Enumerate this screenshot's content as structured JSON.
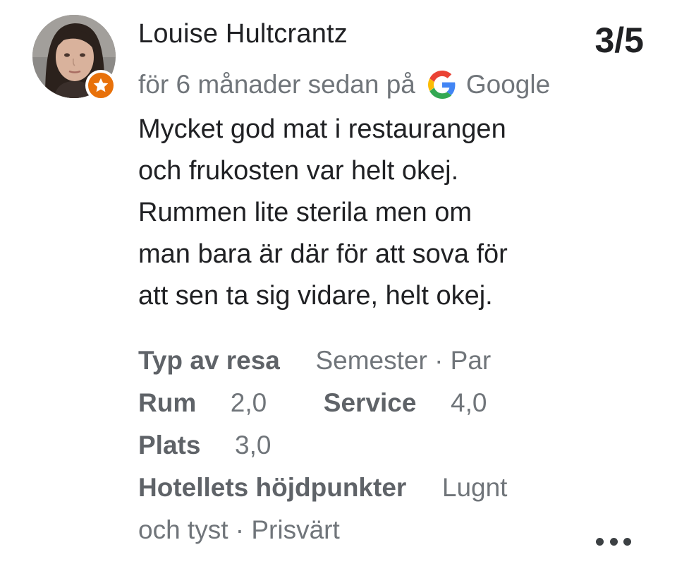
{
  "review": {
    "author": "Louise Hultcrantz",
    "score": "3/5",
    "time": "för 6 månader sedan på",
    "source": "Google",
    "text_lines": [
      "Mycket god mat i restaurangen",
      "och frukosten var helt okej.",
      "Rummen lite sterila men om",
      "man bara är där för att sova för",
      "att sen ta sig vidare, helt okej."
    ],
    "trip_type": {
      "label": "Typ av resa",
      "value": "Semester · Par"
    },
    "ratings": [
      {
        "label": "Rum",
        "value": "2,0"
      },
      {
        "label": "Service",
        "value": "4,0"
      },
      {
        "label": "Plats",
        "value": "3,0"
      }
    ],
    "highlights": {
      "label": "Hotellets höjdpunkter",
      "value_line1": "Lugnt",
      "value_line2": "och tyst · Prisvärt"
    }
  },
  "icons": {
    "avatar": "user-avatar",
    "badge": "local-guide-star-icon",
    "source_logo": "google-g-icon",
    "more": "more-horizontal-icon"
  },
  "colors": {
    "badge": "#e8710a",
    "primary_text": "#202124",
    "secondary_text": "#70757a"
  }
}
